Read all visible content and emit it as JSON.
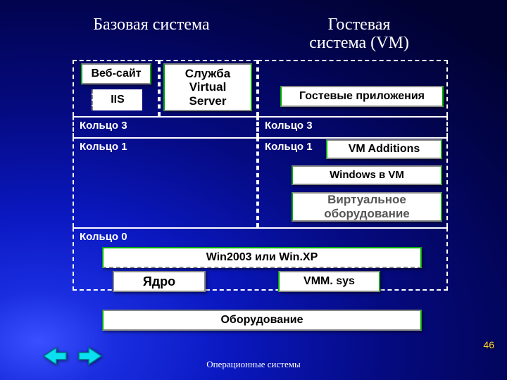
{
  "titles": {
    "left": "Базовая система",
    "right": "Гостевая\nсистема (VM)"
  },
  "rings": {
    "r3l": "Кольцо 3",
    "r3r": "Кольцо 3",
    "r1l": "Кольцо 1",
    "r1r": "Кольцо 1",
    "r0": "Кольцо 0"
  },
  "boxes": {
    "web": "Веб-сайт",
    "iis": "IIS",
    "vsvc": "Служба\nVirtual Server",
    "gapps": "Гостевые приложения",
    "vmad": "VM Additions",
    "winvm": "Windows в VM",
    "vhw": "Виртуальное\nоборудование",
    "win03": "Win2003 или Win.XP",
    "kern": "Ядро",
    "vmm": "VMM. sys",
    "hard": "Оборудование"
  },
  "page": {
    "number": "46",
    "footer": "Операционные системы"
  }
}
